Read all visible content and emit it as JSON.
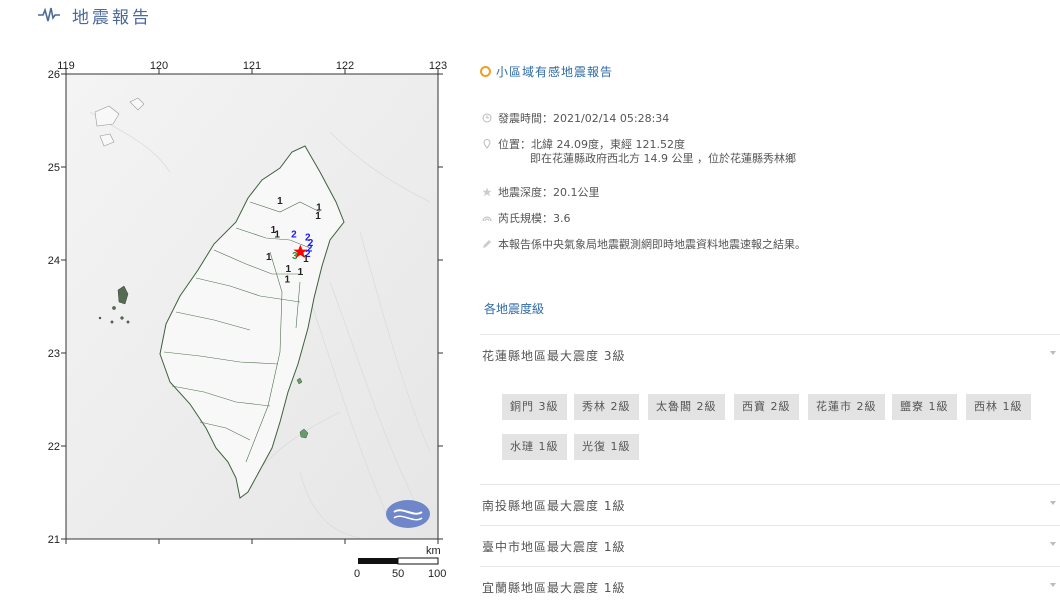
{
  "header": {
    "title": "地震報告",
    "icon": "seismograph-icon",
    "accent": "#4b6a9b"
  },
  "map": {
    "lon_ticks": [
      "119",
      "120",
      "121",
      "122",
      "123"
    ],
    "lat_ticks": [
      "26",
      "25",
      "24",
      "23",
      "22",
      "21"
    ],
    "scale": {
      "unit": "km",
      "labels": [
        "0",
        "50",
        "100"
      ]
    },
    "epicenter": {
      "lat": 24.09,
      "lon": 121.52,
      "symbol": "star",
      "color": "#ff0000"
    },
    "station_marks": [
      {
        "text": "1",
        "lon": 121.3,
        "lat": 24.6,
        "color": "#222"
      },
      {
        "text": "1",
        "lon": 121.72,
        "lat": 24.53,
        "color": "#222"
      },
      {
        "text": "1",
        "lon": 121.71,
        "lat": 24.44,
        "color": "#222"
      },
      {
        "text": "1",
        "lon": 121.23,
        "lat": 24.29,
        "color": "#222"
      },
      {
        "text": "1",
        "lon": 121.27,
        "lat": 24.24,
        "color": "#222"
      },
      {
        "text": "2",
        "lon": 121.45,
        "lat": 24.24,
        "color": "#1a1aff"
      },
      {
        "text": "2",
        "lon": 121.6,
        "lat": 24.21,
        "color": "#1a1aff"
      },
      {
        "text": "2",
        "lon": 121.63,
        "lat": 24.15,
        "color": "#1a1aff"
      },
      {
        "text": "2",
        "lon": 121.62,
        "lat": 24.09,
        "color": "#1a1aff"
      },
      {
        "text": "2",
        "lon": 121.6,
        "lat": 24.03,
        "color": "#1a1aff"
      },
      {
        "text": "3",
        "lon": 121.46,
        "lat": 24.01,
        "color": "#2a9a2a"
      },
      {
        "text": "1",
        "lon": 121.58,
        "lat": 23.98,
        "color": "#222"
      },
      {
        "text": "1",
        "lon": 121.18,
        "lat": 24.0,
        "color": "#222"
      },
      {
        "text": "1",
        "lon": 121.39,
        "lat": 23.87,
        "color": "#222"
      },
      {
        "text": "1",
        "lon": 121.52,
        "lat": 23.84,
        "color": "#222"
      },
      {
        "text": "1",
        "lon": 121.38,
        "lat": 23.76,
        "color": "#222"
      }
    ],
    "logo_icon": "cwb-logo-icon"
  },
  "report": {
    "title": "小區域有感地震報告",
    "time": "發震時間：2021/02/14 05:28:34",
    "location": "位置：北緯 24.09度，東經 121.52度",
    "location_detail": "即在花蓮縣政府西北方 14.9 公里 ，位於花蓮縣秀林鄉",
    "depth": "地震深度：20.1公里",
    "magnitude": "芮氏規模：3.6",
    "note": "本報告係中央氣象局地震觀測網即時地震資料地震速報之結果。"
  },
  "intensity": {
    "section_title": "各地震度級",
    "regions": [
      "花蓮縣地區最大震度 3級",
      "南投縣地區最大震度 1級",
      "臺中市地區最大震度 1級",
      "宜蘭縣地區最大震度 1級"
    ],
    "hualien_chips": [
      "銅門 3級",
      "秀林 2級",
      "太魯閣 2級",
      "西寶 2級",
      "花蓮市 2級",
      "鹽寮 1級",
      "西林 1級",
      "水璉 1級",
      "光復 1級"
    ]
  }
}
